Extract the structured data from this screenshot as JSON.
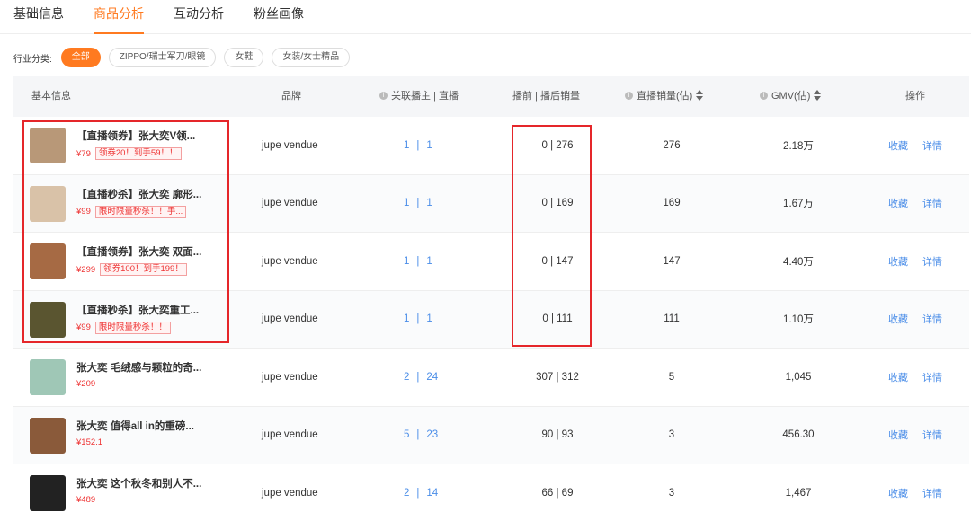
{
  "tabs": [
    {
      "label": "基础信息",
      "active": false
    },
    {
      "label": "商品分析",
      "active": true
    },
    {
      "label": "互动分析",
      "active": false
    },
    {
      "label": "粉丝画像",
      "active": false
    }
  ],
  "filter": {
    "label": "行业分类:",
    "chips": [
      {
        "label": "全部",
        "active": true
      },
      {
        "label": "ZIPPO/瑞士军刀/眼镜",
        "active": false
      },
      {
        "label": "女鞋",
        "active": false
      },
      {
        "label": "女装/女士精品",
        "active": false
      }
    ]
  },
  "table": {
    "headers": {
      "info": "基本信息",
      "brand": "品牌",
      "related": "关联播主 | 直播",
      "prepost": "播前 | 播后销量",
      "live_sales": "直播销量(估)",
      "gmv": "GMV(估)",
      "ops": "操作"
    },
    "rows": [
      {
        "title": "【直播领券】张大奕V领...",
        "price": "¥79",
        "promo": "领券20！到手59！！",
        "brand": "jupe vendue",
        "anchors": "1",
        "lives": "1",
        "prepost": "0 | 276",
        "live_sales": "276",
        "gmv": "2.18万",
        "fav": "收藏",
        "detail": "详情",
        "thumb_color": "#b89878"
      },
      {
        "title": "【直播秒杀】张大奕 廓形...",
        "price": "¥99",
        "promo": "限时限量秒杀！！手...",
        "brand": "jupe vendue",
        "anchors": "1",
        "lives": "1",
        "prepost": "0 | 169",
        "live_sales": "169",
        "gmv": "1.67万",
        "fav": "收藏",
        "detail": "详情",
        "thumb_color": "#d9c2a8"
      },
      {
        "title": "【直播领券】张大奕 双面...",
        "price": "¥299",
        "promo": "领券100！到手199！",
        "brand": "jupe vendue",
        "anchors": "1",
        "lives": "1",
        "prepost": "0 | 147",
        "live_sales": "147",
        "gmv": "4.40万",
        "fav": "收藏",
        "detail": "详情",
        "thumb_color": "#a66a44"
      },
      {
        "title": "【直播秒杀】张大奕重工...",
        "price": "¥99",
        "promo": "限时限量秒杀！！",
        "brand": "jupe vendue",
        "anchors": "1",
        "lives": "1",
        "prepost": "0 | 111",
        "live_sales": "111",
        "gmv": "1.10万",
        "fav": "收藏",
        "detail": "详情",
        "thumb_color": "#5a5530"
      },
      {
        "title": "张大奕 毛绒感与颗粒的奇...",
        "price": "¥209",
        "promo": "",
        "brand": "jupe vendue",
        "anchors": "2",
        "lives": "24",
        "prepost": "307 | 312",
        "live_sales": "5",
        "gmv": "1,045",
        "fav": "收藏",
        "detail": "详情",
        "thumb_color": "#9fc7b6"
      },
      {
        "title": "张大奕 值得all in的重磅...",
        "price": "¥152.1",
        "promo": "",
        "brand": "jupe vendue",
        "anchors": "5",
        "lives": "23",
        "prepost": "90 | 93",
        "live_sales": "3",
        "gmv": "456.30",
        "fav": "收藏",
        "detail": "详情",
        "thumb_color": "#8a5a3a"
      },
      {
        "title": "张大奕 这个秋冬和别人不...",
        "price": "¥489",
        "promo": "",
        "brand": "jupe vendue",
        "anchors": "2",
        "lives": "14",
        "prepost": "66 | 69",
        "live_sales": "3",
        "gmv": "1,467",
        "fav": "收藏",
        "detail": "详情",
        "thumb_color": "#222222"
      }
    ]
  },
  "colors": {
    "accent": "#ff7a20",
    "link": "#4a8de8",
    "price": "#e33333",
    "highlight": "#e5262a"
  }
}
